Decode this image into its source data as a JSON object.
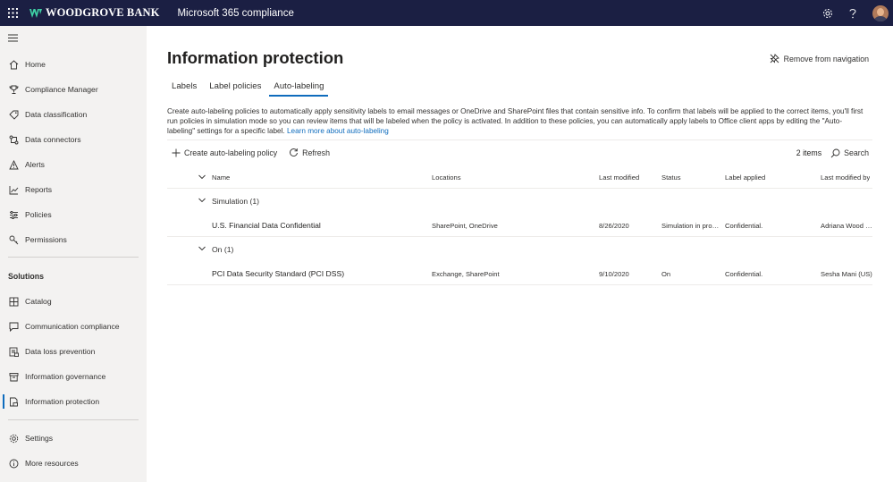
{
  "topbar": {
    "brand": "WOODGROVE BANK",
    "app_name": "Microsoft 365 compliance"
  },
  "sidebar": {
    "items": [
      {
        "label": "Home",
        "icon": "home-icon"
      },
      {
        "label": "Compliance Manager",
        "icon": "trophy-icon"
      },
      {
        "label": "Data classification",
        "icon": "tag-icon"
      },
      {
        "label": "Data connectors",
        "icon": "connector-icon"
      },
      {
        "label": "Alerts",
        "icon": "alert-icon"
      },
      {
        "label": "Reports",
        "icon": "chart-icon"
      },
      {
        "label": "Policies",
        "icon": "policies-icon"
      },
      {
        "label": "Permissions",
        "icon": "key-icon"
      }
    ],
    "solutions_heading": "Solutions",
    "solutions": [
      {
        "label": "Catalog",
        "icon": "catalog-icon"
      },
      {
        "label": "Communication compliance",
        "icon": "chat-icon"
      },
      {
        "label": "Data loss prevention",
        "icon": "dlp-icon"
      },
      {
        "label": "Information governance",
        "icon": "archive-icon"
      },
      {
        "label": "Information protection",
        "icon": "lock-doc-icon"
      }
    ],
    "footer": [
      {
        "label": "Settings",
        "icon": "gear-icon"
      },
      {
        "label": "More resources",
        "icon": "info-icon"
      }
    ]
  },
  "page": {
    "title": "Information protection",
    "remove_nav": "Remove from navigation",
    "tabs": [
      "Labels",
      "Label policies",
      "Auto-labeling"
    ],
    "description": "Create auto-labeling policies to automatically apply sensitivity labels to email messages or OneDrive and SharePoint files that contain sensitive info. To confirm that labels will be applied to the correct items, you'll first run policies in simulation mode so you can review items that will be labeled when the policy is activated. In addition to these policies, you can automatically apply labels to Office client apps by editing the \"Auto-labeling\" settings for a specific label.",
    "learn_more": "Learn more about auto-labeling"
  },
  "commands": {
    "create": "Create auto-labeling policy",
    "refresh": "Refresh",
    "items_count": "2 items",
    "search": "Search"
  },
  "table": {
    "columns": {
      "name": "Name",
      "locations": "Locations",
      "last_modified": "Last modified",
      "status": "Status",
      "label_applied": "Label applied",
      "last_modified_by": "Last modified by"
    },
    "groups": [
      {
        "title": "Simulation (1)",
        "rows": [
          {
            "name": "U.S. Financial Data Confidential",
            "locations": "SharePoint, OneDrive",
            "last_modified": "8/26/2020",
            "status": "Simulation in progr...",
            "label_applied": "Confidential.",
            "last_modified_by": "Adriana Wood (..."
          }
        ]
      },
      {
        "title": "On (1)",
        "rows": [
          {
            "name": "PCI Data Security Standard (PCI DSS)",
            "locations": "Exchange, SharePoint",
            "last_modified": "9/10/2020",
            "status": "On",
            "label_applied": "Confidential.",
            "last_modified_by": "Sesha Mani (US)"
          }
        ]
      }
    ]
  },
  "colors": {
    "topbar": "#1b1f43",
    "sidebar": "#f3f2f1",
    "accent": "#0f6cbd"
  }
}
